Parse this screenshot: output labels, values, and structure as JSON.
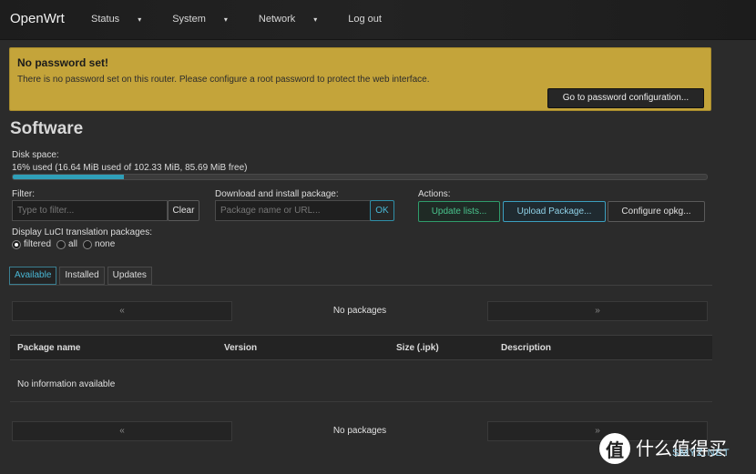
{
  "header": {
    "brand": "OpenWrt",
    "menu": [
      {
        "label": "Status",
        "caret": "▾"
      },
      {
        "label": "System",
        "caret": "▾"
      },
      {
        "label": "Network",
        "caret": "▾"
      },
      {
        "label": "Log out",
        "caret": ""
      }
    ]
  },
  "alert": {
    "title": "No password set!",
    "message": "There is no password set on this router. Please configure a root password to protect the web interface.",
    "button": "Go to password configuration..."
  },
  "page": {
    "title": "Software"
  },
  "disk": {
    "label": "Disk space:",
    "usage": "16% used (16.64 MiB used of 102.33 MiB, 85.69 MiB free)",
    "percent": 16
  },
  "filter": {
    "label": "Filter:",
    "placeholder": "Type to filter...",
    "clear": "Clear"
  },
  "download": {
    "label": "Download and install package:",
    "placeholder": "Package name or URL...",
    "ok": "OK"
  },
  "actions": {
    "label": "Actions:",
    "update": "Update lists...",
    "upload": "Upload Package...",
    "configure": "Configure opkg..."
  },
  "translation": {
    "label": "Display LuCI translation packages:",
    "options": [
      {
        "label": "filtered",
        "selected": true
      },
      {
        "label": "all",
        "selected": false
      },
      {
        "label": "none",
        "selected": false
      }
    ]
  },
  "tabs": [
    {
      "label": "Available",
      "active": true
    },
    {
      "label": "Installed",
      "active": false
    },
    {
      "label": "Updates",
      "active": false
    }
  ],
  "pager": {
    "prev": "«",
    "next": "»",
    "status": "No packages"
  },
  "table": {
    "columns": [
      "Package name",
      "Version",
      "Size (.ipk)",
      "Description"
    ],
    "empty": "No information available"
  },
  "watermark": {
    "logo": "值",
    "text": "什么值得买",
    "sub": "SMYZ.NET"
  },
  "colors": {
    "accent": "#2f9fb8",
    "alert": "#c4a43a",
    "update_btn": "#49c48d"
  }
}
